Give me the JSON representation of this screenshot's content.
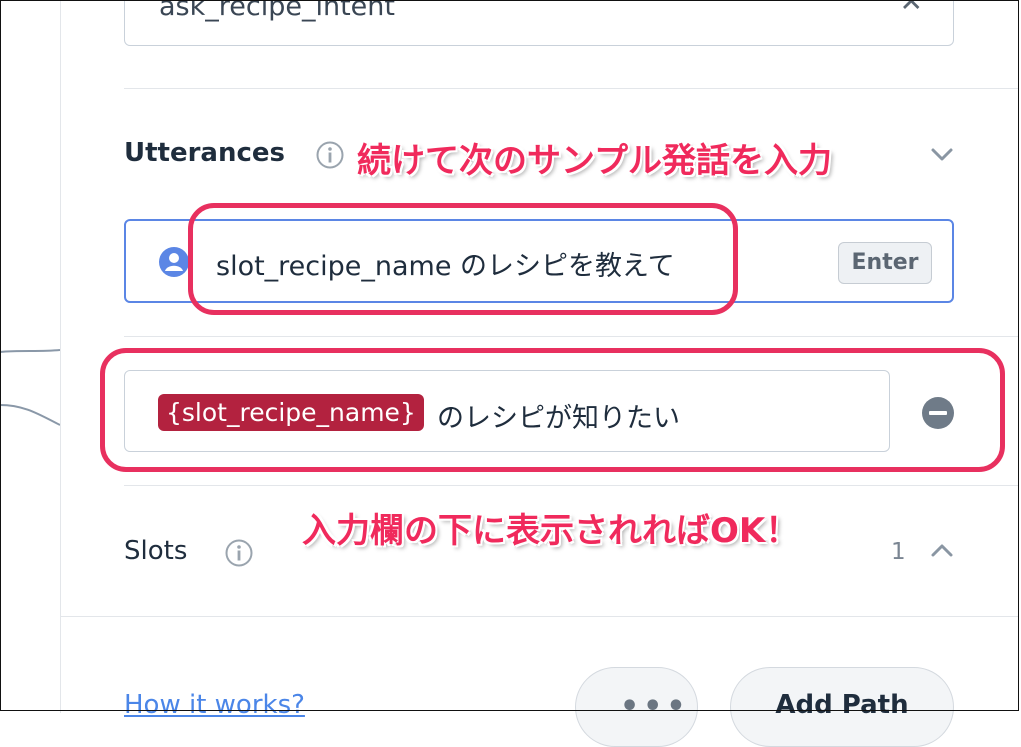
{
  "intent_field": {
    "value": "ask_recipe_intent",
    "clear_icon": "close-icon"
  },
  "utterances": {
    "title": "Utterances",
    "info_icon": "info-icon",
    "chevron_icon": "chevron-down-icon",
    "input": {
      "value": "slot_recipe_name のレシピを教えて",
      "avatar_icon": "user-icon",
      "enter_label": "Enter"
    },
    "items": [
      {
        "slot": "{slot_recipe_name}",
        "rest": "のレシピが知りたい",
        "remove_icon": "minus-circle-icon"
      }
    ]
  },
  "slots": {
    "title": "Slots",
    "info_icon": "info-icon",
    "count": "1",
    "chevron_icon": "chevron-up-icon"
  },
  "footer": {
    "link": "How it works?",
    "more_label": "•••",
    "add_path_label": "Add Path"
  },
  "annotations": {
    "callout_1": "続けて次のサンプル発話を入力",
    "callout_2": "入力欄の下に表示されればOK！",
    "color": "#e8305f"
  },
  "colors": {
    "slot_tag": "#b3223f",
    "accent": "#5b86e5",
    "link": "#4b86e8"
  }
}
